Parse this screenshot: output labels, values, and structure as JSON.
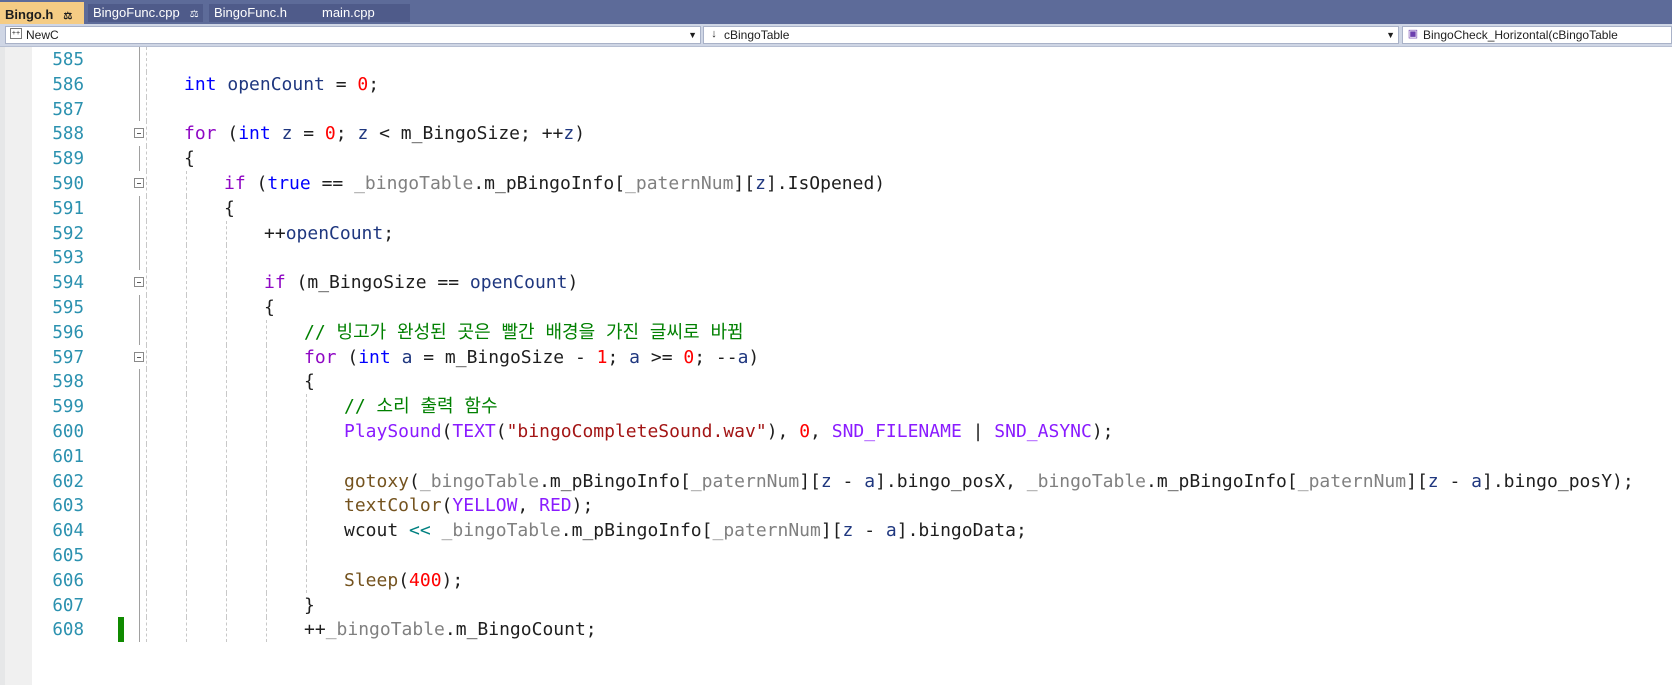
{
  "tabs": [
    {
      "label": "Bingo.h",
      "active": true,
      "pinned": true
    },
    {
      "label": "BingoFunc.cpp",
      "active": false,
      "pinned": true
    },
    {
      "label": "BingoFunc.h",
      "active": false,
      "pinned": false
    },
    {
      "label": "main.cpp",
      "active": false,
      "pinned": false
    }
  ],
  "nav": {
    "project": "NewC",
    "scope": "cBingoTable",
    "member": "BingoCheck_Horizontal(cBingoTable"
  },
  "icons": {
    "project": "project-icon",
    "scope": "class-icon",
    "member": "method-icon",
    "dropdown": "chevron-down-icon",
    "pin": "pin-icon"
  },
  "colors": {
    "keyword": "#0000ff",
    "control": "#8f08c4",
    "comment": "#008000",
    "string": "#a31515",
    "number": "#ff0000",
    "line_number": "#2b91af",
    "change_bar": "#108a00",
    "active_tab": "#f5cc84"
  },
  "lines": [
    {
      "n": "585",
      "t": [
        {
          "s": "",
          "c": "plain"
        }
      ],
      "indent": 0
    },
    {
      "n": "586",
      "t": [
        {
          "s": "int",
          "c": "kw"
        },
        {
          "s": " ",
          "c": "plain"
        },
        {
          "s": "openCount",
          "c": "var"
        },
        {
          "s": " = ",
          "c": "plain"
        },
        {
          "s": "0",
          "c": "num"
        },
        {
          "s": ";",
          "c": "plain"
        }
      ],
      "indent": 0
    },
    {
      "n": "587",
      "t": [
        {
          "s": "",
          "c": "plain"
        }
      ],
      "indent": 0
    },
    {
      "n": "588",
      "t": [
        {
          "s": "for",
          "c": "kwc"
        },
        {
          "s": " (",
          "c": "plain"
        },
        {
          "s": "int",
          "c": "kw"
        },
        {
          "s": " ",
          "c": "plain"
        },
        {
          "s": "z",
          "c": "var"
        },
        {
          "s": " = ",
          "c": "plain"
        },
        {
          "s": "0",
          "c": "num"
        },
        {
          "s": "; ",
          "c": "plain"
        },
        {
          "s": "z",
          "c": "var"
        },
        {
          "s": " < m_BingoSize; ++",
          "c": "plain"
        },
        {
          "s": "z",
          "c": "var"
        },
        {
          "s": ")",
          "c": "plain"
        }
      ],
      "indent": 0,
      "fold": true
    },
    {
      "n": "589",
      "t": [
        {
          "s": "{",
          "c": "plain"
        }
      ],
      "indent": 0
    },
    {
      "n": "590",
      "t": [
        {
          "s": "if",
          "c": "kwc"
        },
        {
          "s": " (",
          "c": "plain"
        },
        {
          "s": "true",
          "c": "kw"
        },
        {
          "s": " == ",
          "c": "plain"
        },
        {
          "s": "_bingoTable",
          "c": "fld"
        },
        {
          "s": ".m_pBingoInfo[",
          "c": "plain"
        },
        {
          "s": "_paternNum",
          "c": "fld"
        },
        {
          "s": "][",
          "c": "plain"
        },
        {
          "s": "z",
          "c": "var"
        },
        {
          "s": "].IsOpened)",
          "c": "plain"
        }
      ],
      "indent": 1,
      "fold": true
    },
    {
      "n": "591",
      "t": [
        {
          "s": "{",
          "c": "plain"
        }
      ],
      "indent": 1
    },
    {
      "n": "592",
      "t": [
        {
          "s": "++",
          "c": "plain"
        },
        {
          "s": "openCount",
          "c": "var"
        },
        {
          "s": ";",
          "c": "plain"
        }
      ],
      "indent": 2
    },
    {
      "n": "593",
      "t": [
        {
          "s": "",
          "c": "plain"
        }
      ],
      "indent": 2
    },
    {
      "n": "594",
      "t": [
        {
          "s": "if",
          "c": "kwc"
        },
        {
          "s": " (m_BingoSize == ",
          "c": "plain"
        },
        {
          "s": "openCount",
          "c": "var"
        },
        {
          "s": ")",
          "c": "plain"
        }
      ],
      "indent": 2,
      "fold": true
    },
    {
      "n": "595",
      "t": [
        {
          "s": "{",
          "c": "plain"
        }
      ],
      "indent": 2
    },
    {
      "n": "596",
      "t": [
        {
          "s": "// 빙고가 완성된 곳은 빨간 배경을 가진 글씨로 바뀜",
          "c": "cmt"
        }
      ],
      "indent": 3
    },
    {
      "n": "597",
      "t": [
        {
          "s": "for",
          "c": "kwc"
        },
        {
          "s": " (",
          "c": "plain"
        },
        {
          "s": "int",
          "c": "kw"
        },
        {
          "s": " ",
          "c": "plain"
        },
        {
          "s": "a",
          "c": "var"
        },
        {
          "s": " = m_BingoSize - ",
          "c": "plain"
        },
        {
          "s": "1",
          "c": "num"
        },
        {
          "s": "; ",
          "c": "plain"
        },
        {
          "s": "a",
          "c": "var"
        },
        {
          "s": " >= ",
          "c": "plain"
        },
        {
          "s": "0",
          "c": "num"
        },
        {
          "s": "; --",
          "c": "plain"
        },
        {
          "s": "a",
          "c": "var"
        },
        {
          "s": ")",
          "c": "plain"
        }
      ],
      "indent": 3,
      "fold": true
    },
    {
      "n": "598",
      "t": [
        {
          "s": "{",
          "c": "plain"
        }
      ],
      "indent": 3
    },
    {
      "n": "599",
      "t": [
        {
          "s": "// 소리 출력 함수",
          "c": "cmt"
        }
      ],
      "indent": 4
    },
    {
      "n": "600",
      "t": [
        {
          "s": "PlaySound",
          "c": "mac"
        },
        {
          "s": "(",
          "c": "plain"
        },
        {
          "s": "TEXT",
          "c": "mac"
        },
        {
          "s": "(",
          "c": "plain"
        },
        {
          "s": "\"bingoCompleteSound.wav\"",
          "c": "str"
        },
        {
          "s": "), ",
          "c": "plain"
        },
        {
          "s": "0",
          "c": "num"
        },
        {
          "s": ", ",
          "c": "plain"
        },
        {
          "s": "SND_FILENAME",
          "c": "mac"
        },
        {
          "s": " | ",
          "c": "plain"
        },
        {
          "s": "SND_ASYNC",
          "c": "mac"
        },
        {
          "s": ");",
          "c": "plain"
        }
      ],
      "indent": 4
    },
    {
      "n": "601",
      "t": [
        {
          "s": "",
          "c": "plain"
        }
      ],
      "indent": 4
    },
    {
      "n": "602",
      "t": [
        {
          "s": "gotoxy",
          "c": "fn"
        },
        {
          "s": "(",
          "c": "plain"
        },
        {
          "s": "_bingoTable",
          "c": "fld"
        },
        {
          "s": ".m_pBingoInfo[",
          "c": "plain"
        },
        {
          "s": "_paternNum",
          "c": "fld"
        },
        {
          "s": "][",
          "c": "plain"
        },
        {
          "s": "z",
          "c": "var"
        },
        {
          "s": " - ",
          "c": "plain"
        },
        {
          "s": "a",
          "c": "var"
        },
        {
          "s": "].bingo_posX, ",
          "c": "plain"
        },
        {
          "s": "_bingoTable",
          "c": "fld"
        },
        {
          "s": ".m_pBingoInfo[",
          "c": "plain"
        },
        {
          "s": "_paternNum",
          "c": "fld"
        },
        {
          "s": "][",
          "c": "plain"
        },
        {
          "s": "z",
          "c": "var"
        },
        {
          "s": " - ",
          "c": "plain"
        },
        {
          "s": "a",
          "c": "var"
        },
        {
          "s": "].bingo_posY);",
          "c": "plain"
        }
      ],
      "indent": 4
    },
    {
      "n": "603",
      "t": [
        {
          "s": "textColor",
          "c": "fn"
        },
        {
          "s": "(",
          "c": "plain"
        },
        {
          "s": "YELLOW",
          "c": "mac"
        },
        {
          "s": ", ",
          "c": "plain"
        },
        {
          "s": "RED",
          "c": "mac"
        },
        {
          "s": ");",
          "c": "plain"
        }
      ],
      "indent": 4
    },
    {
      "n": "604",
      "t": [
        {
          "s": "wcout",
          "c": "plain"
        },
        {
          "s": " << ",
          "c": "op"
        },
        {
          "s": "_bingoTable",
          "c": "fld"
        },
        {
          "s": ".m_pBingoInfo[",
          "c": "plain"
        },
        {
          "s": "_paternNum",
          "c": "fld"
        },
        {
          "s": "][",
          "c": "plain"
        },
        {
          "s": "z",
          "c": "var"
        },
        {
          "s": " - ",
          "c": "plain"
        },
        {
          "s": "a",
          "c": "var"
        },
        {
          "s": "].bingoData;",
          "c": "plain"
        }
      ],
      "indent": 4
    },
    {
      "n": "605",
      "t": [
        {
          "s": "",
          "c": "plain"
        }
      ],
      "indent": 4
    },
    {
      "n": "606",
      "t": [
        {
          "s": "Sleep",
          "c": "fn"
        },
        {
          "s": "(",
          "c": "plain"
        },
        {
          "s": "400",
          "c": "num"
        },
        {
          "s": ");",
          "c": "plain"
        }
      ],
      "indent": 4
    },
    {
      "n": "607",
      "t": [
        {
          "s": "}",
          "c": "plain"
        }
      ],
      "indent": 3
    },
    {
      "n": "608",
      "t": [
        {
          "s": "++",
          "c": "plain"
        },
        {
          "s": "_bingoTable",
          "c": "fld"
        },
        {
          "s": ".m_BingoCount;",
          "c": "plain"
        }
      ],
      "indent": 3,
      "changed": true
    }
  ]
}
